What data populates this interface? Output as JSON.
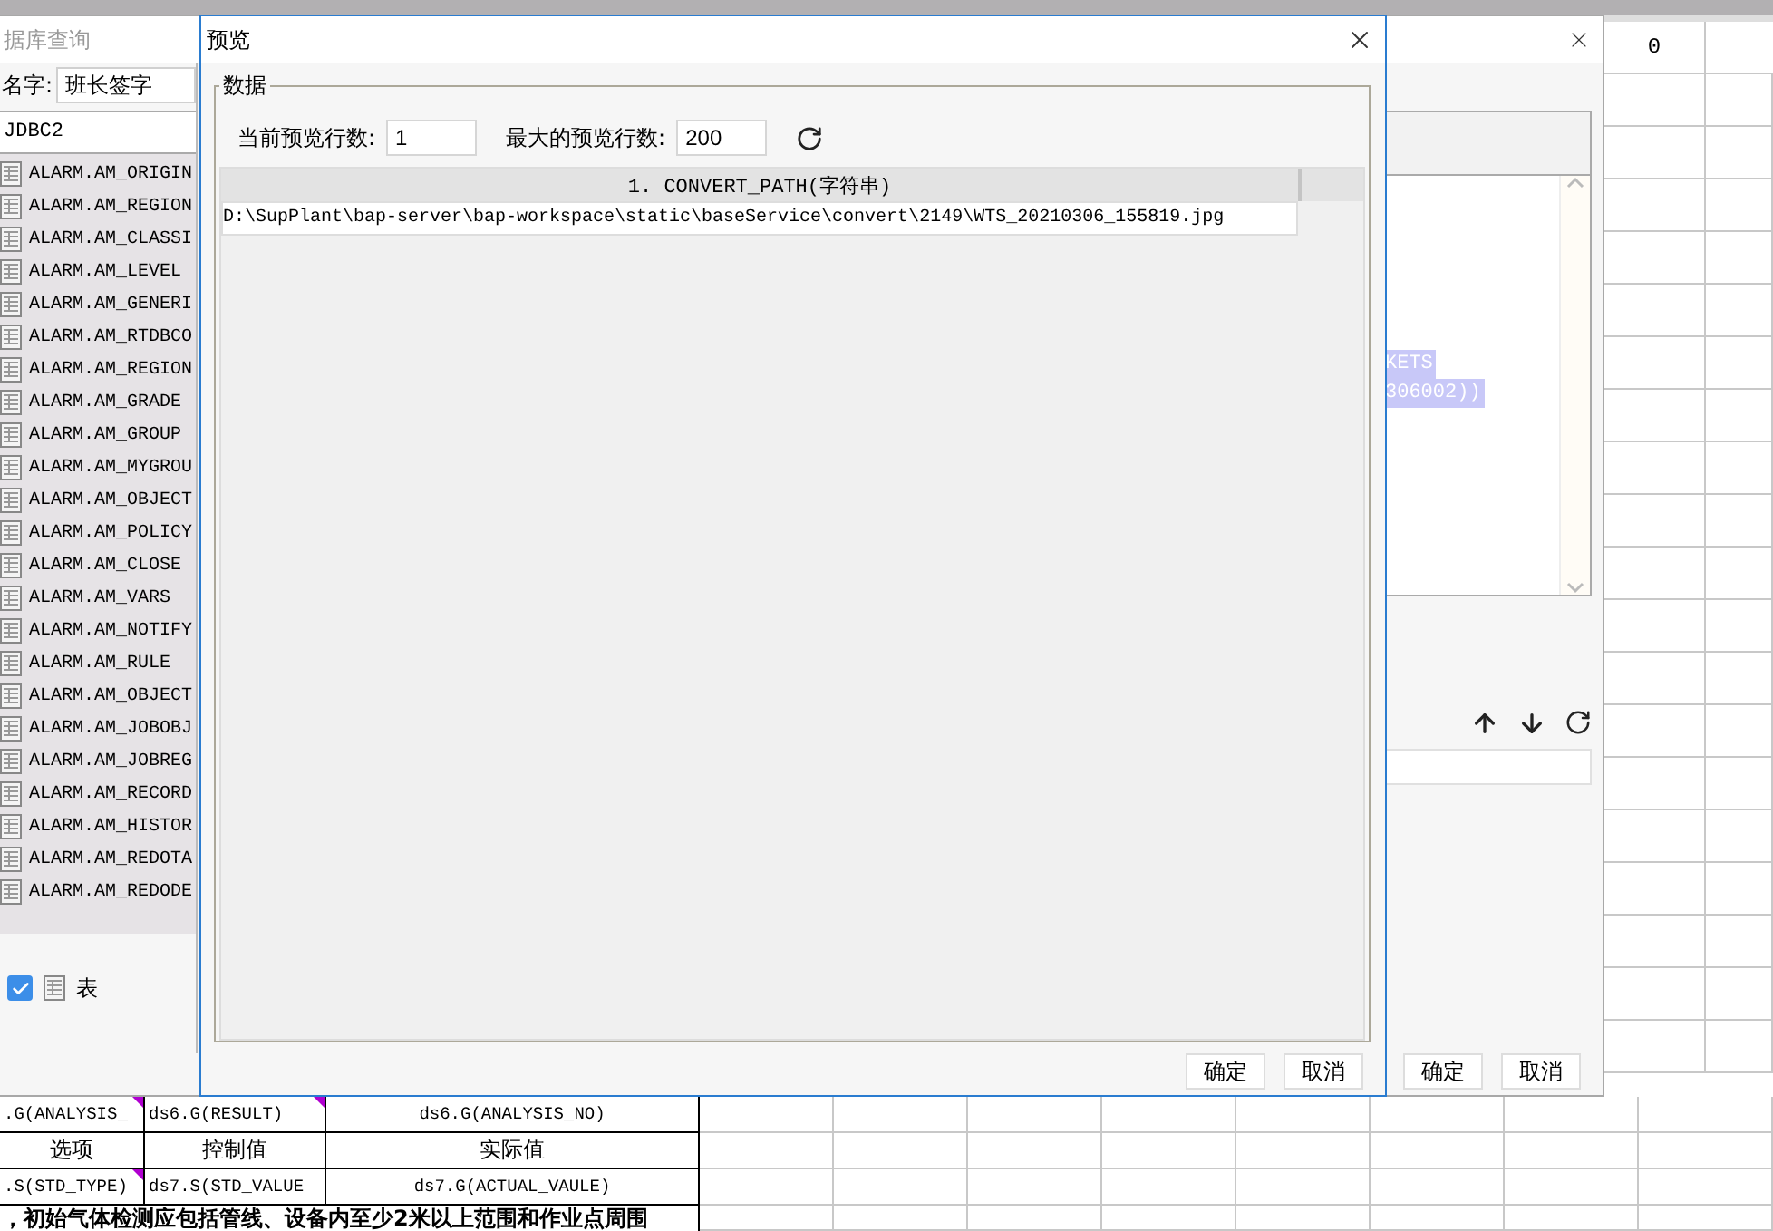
{
  "sheet": {
    "column_header": "0",
    "rows": [
      {
        "cells": [
          {
            "text": ".G(ANALYSIS_",
            "comment": true
          },
          {
            "text": "ds6.G(RESULT)",
            "comment": true
          },
          {
            "text": "ds6.G(ANALYSIS_NO)",
            "comment": false
          }
        ]
      },
      {
        "cells": [
          {
            "text": "选项",
            "comment": false
          },
          {
            "text": "控制值",
            "comment": false
          },
          {
            "text": "实际值",
            "comment": false
          }
        ]
      },
      {
        "cells": [
          {
            "text": ".S(STD_TYPE)",
            "comment": true
          },
          {
            "text": "ds7.S(STD_VALUE",
            "comment": false
          },
          {
            "text": "ds7.G(ACTUAL_VAULE)",
            "comment": false
          }
        ]
      }
    ],
    "note": "，初始气体检测应包括管线、设备内至少2米以上范围和作业点周围"
  },
  "query_dialog": {
    "title": "据库查询",
    "name_label": "名字:",
    "name_value": "班长签字",
    "connection": "JDBC2",
    "tables": [
      "ALARM.AM_ORIGIN",
      "ALARM.AM_REGION",
      "ALARM.AM_CLASSI",
      "ALARM.AM_LEVEL",
      "ALARM.AM_GENERI",
      "ALARM.AM_RTDBCO",
      "ALARM.AM_REGION",
      "ALARM.AM_GRADE",
      "ALARM.AM_GROUP",
      "ALARM.AM_MYGROU",
      "ALARM.AM_OBJECT",
      "ALARM.AM_POLICY",
      "ALARM.AM_CLOSE",
      "ALARM.AM_VARS",
      "ALARM.AM_NOTIFY",
      "ALARM.AM_RULE",
      "ALARM.AM_OBJECT",
      "ALARM.AM_JOBOBJ",
      "ALARM.AM_JOBREG",
      "ALARM.AM_RECORD",
      "ALARM.AM_HISTOR",
      "ALARM.AM_REDOTA",
      "ALARM.AM_REDODE"
    ],
    "show_tables": {
      "label": "表",
      "checked": true
    },
    "sql_lines": [
      "KETS",
      "306002))"
    ],
    "buttons": [
      "确定",
      "取消"
    ]
  },
  "preview_dialog": {
    "title": "预览",
    "group_title": "数据",
    "current_rows_label": "当前预览行数:",
    "current_rows": "1",
    "max_rows_label": "最大的预览行数:",
    "max_rows": "200",
    "table": {
      "columns": [
        "1. CONVERT_PATH(字符串)"
      ],
      "rows": [
        [
          "D:\\SupPlant\\bap-server\\bap-workspace\\static\\baseService\\convert\\2149\\WTS_20210306_155819.jpg"
        ]
      ]
    },
    "buttons": [
      "确定",
      "取消"
    ]
  }
}
